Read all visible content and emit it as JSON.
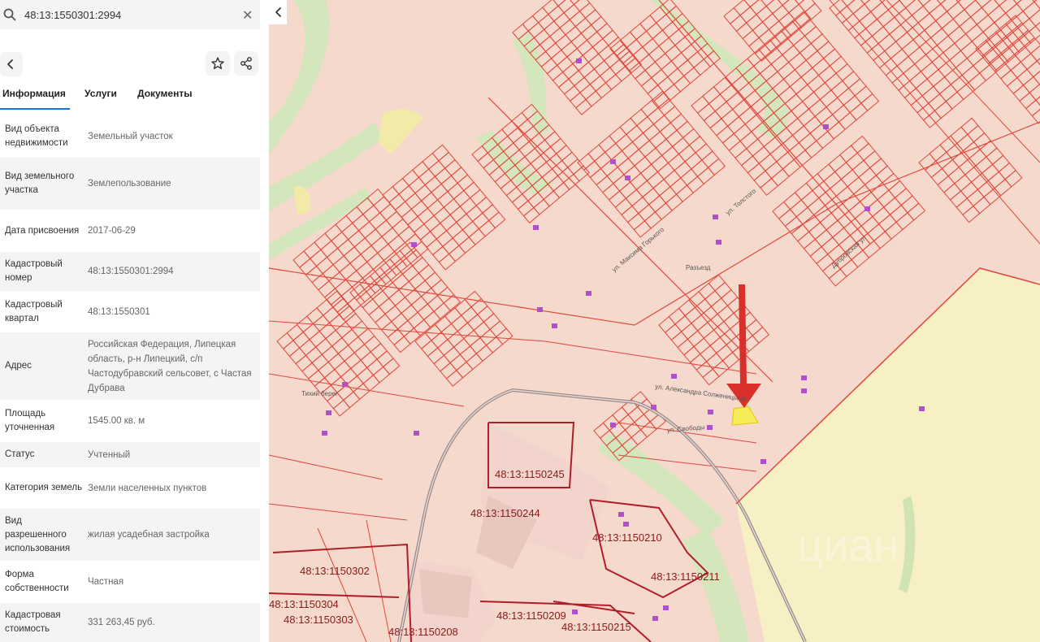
{
  "search": {
    "value": "48:13:1550301:2994",
    "icon": "search-icon",
    "clear_icon": "close-icon",
    "clear_glyph": "✕"
  },
  "toolbar": {
    "back_icon": "chevron-left-icon",
    "favorite_icon": "star-icon",
    "share_icon": "share-icon"
  },
  "tabs": [
    {
      "label": "Информация",
      "active": true
    },
    {
      "label": "Услуги",
      "active": false
    },
    {
      "label": "Документы",
      "active": false
    }
  ],
  "info_rows": [
    {
      "label": "Вид объекта недвижимости",
      "value": "Земельный участок"
    },
    {
      "label": "Вид земельного участка",
      "value": "Землепользование"
    },
    {
      "label": "Дата присвоения",
      "value": "2017-06-29"
    },
    {
      "label": "Кадастровый номер",
      "value": "48:13:1550301:2994"
    },
    {
      "label": "Кадастровый квартал",
      "value": "48:13:1550301"
    },
    {
      "label": "Адрес",
      "value": "Российская Федерация, Липецкая область, р-н Липецкий, с/п Частодубравский сельсовет, с Частая Дубрава"
    },
    {
      "label": "Площадь уточненная",
      "value": "1545.00 кв. м"
    },
    {
      "label": "Статус",
      "value": "Учтенный"
    },
    {
      "label": "Категория земель",
      "value": "Земли населенных пунктов"
    },
    {
      "label": "Вид разрешенного использования",
      "value": "жилая усадебная застройка"
    },
    {
      "label": "Форма собственности",
      "value": "Частная"
    },
    {
      "label": "Кадастровая стоимость",
      "value": "331 263,45 руб."
    }
  ],
  "map": {
    "collapse_icon": "chevron-left-icon",
    "parcel_labels": [
      "48:13:1150245",
      "48:13:1150244",
      "48:13:1150210",
      "48:13:1150211",
      "48:13:1150302",
      "48:13:1150304",
      "48:13:1150303",
      "48:13:1150209",
      "48:13:1150208",
      "48:13:1150215"
    ],
    "street_labels": [
      "ул. Александра Солженицына",
      "ул. Свободы",
      "ул. Максима Горького",
      "ул. Толстого",
      "Тихий берег",
      "Разъезд",
      "Дубровская ул"
    ],
    "watermark": "циан",
    "colors": {
      "land": "#f5d9cc",
      "parcel_line": "#e0473c",
      "field": "#f7f0c4",
      "green": "#d3e6bc",
      "selected_parcel": "#f5ec5a",
      "pointer_arrow": "#d9302b",
      "road": "#9a8a8a"
    }
  }
}
